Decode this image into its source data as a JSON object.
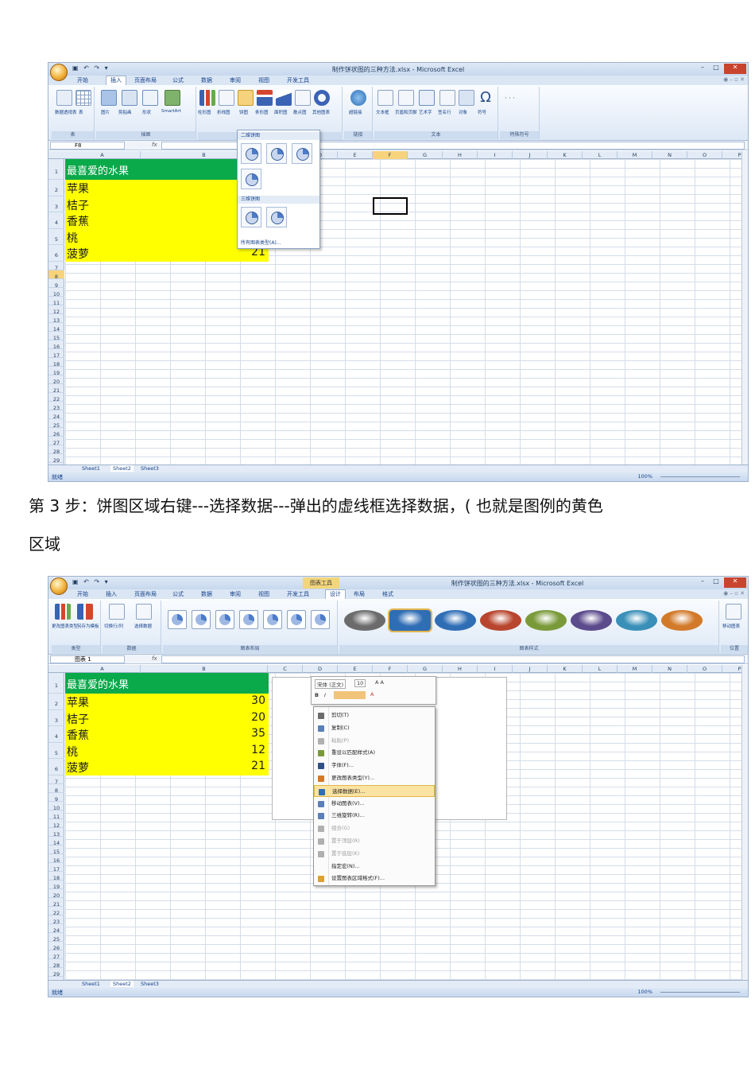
{
  "caption": {
    "line1": "第 3 步：饼图区域右键---选择数据---弹出的虚线框选择数据，( 也就是图例的黄色",
    "line2": "区域"
  },
  "screenshot1": {
    "window_title": "制作饼状图的三种方法.xlsx - Microsoft Excel",
    "tabs": [
      "开始",
      "插入",
      "页面布局",
      "公式",
      "数据",
      "审阅",
      "视图",
      "开发工具"
    ],
    "active_tab": "插入",
    "ribbon_buttons": [
      "数据透视表",
      "表",
      "图片",
      "剪贴画",
      "形状",
      "SmartArt",
      "柱形图",
      "折线图",
      "饼图",
      "条形图",
      "面积图",
      "散点图",
      "其他图表",
      "超链接",
      "文本框",
      "页眉和页脚",
      "艺术字",
      "签名行",
      "对象",
      "符号",
      "特殊符号"
    ],
    "groups": [
      "表",
      "插图",
      "图表",
      "链接",
      "文本",
      "特殊符号"
    ],
    "name_box": "F8",
    "fx": "fx",
    "columns": [
      "A",
      "B",
      "C",
      "D",
      "E",
      "F",
      "G",
      "H",
      "I",
      "J",
      "K",
      "L",
      "M",
      "N",
      "O",
      "P"
    ],
    "selected_column": "F",
    "selected_row": "8",
    "dropdown": {
      "header_2d": "二维饼图",
      "header_3d": "三维饼图",
      "footer": "所有图表类型(A)..."
    },
    "table": {
      "header": "最喜爱的水果",
      "rows": [
        {
          "name": "苹果",
          "value": ""
        },
        {
          "name": "桔子",
          "value": ""
        },
        {
          "name": "香蕉",
          "value": ""
        },
        {
          "name": "桃",
          "value": ""
        },
        {
          "name": "菠萝",
          "value": "21"
        }
      ]
    },
    "sheet_tabs": [
      "Sheet1",
      "Sheet2",
      "Sheet3"
    ],
    "status": "就绪",
    "zoom": "100%"
  },
  "screenshot2": {
    "window_title": "制作饼状图的三种方法.xlsx - Microsoft Excel",
    "tool_title": "图表工具",
    "tabs": [
      "开始",
      "插入",
      "页面布局",
      "公式",
      "数据",
      "审阅",
      "视图",
      "开发工具",
      "设计",
      "布局",
      "格式"
    ],
    "active_tab": "设计",
    "ribbon_buttons": [
      "更改图表类型",
      "另存为模板",
      "切换行/列",
      "选择数据",
      "移动图表"
    ],
    "groups": [
      "类型",
      "数据",
      "图表布局",
      "图表样式",
      "位置"
    ],
    "name_box": "图表 1",
    "fx": "fx",
    "columns": [
      "A",
      "B",
      "C",
      "D",
      "E",
      "F",
      "G",
      "H",
      "I",
      "J",
      "K",
      "L",
      "M",
      "N",
      "O",
      "P"
    ],
    "table": {
      "header": "最喜爱的水果",
      "rows": [
        {
          "name": "苹果",
          "value": "30"
        },
        {
          "name": "桔子",
          "value": "20"
        },
        {
          "name": "香蕉",
          "value": "35"
        },
        {
          "name": "桃",
          "value": "12"
        },
        {
          "name": "菠萝",
          "value": "21"
        }
      ]
    },
    "mini_toolbar": {
      "font": "宋体 (正文)",
      "size": "10"
    },
    "context_menu": [
      {
        "label": "剪切(T)",
        "disabled": false
      },
      {
        "label": "复制(C)",
        "disabled": false
      },
      {
        "label": "粘贴(P)",
        "disabled": true
      },
      {
        "label": "重设以匹配样式(A)",
        "disabled": false
      },
      {
        "label": "字体(F)...",
        "disabled": false
      },
      {
        "label": "更改图表类型(Y)...",
        "disabled": false
      },
      {
        "label": "选择数据(E)...",
        "disabled": false,
        "highlight": true
      },
      {
        "label": "移动图表(V)...",
        "disabled": false
      },
      {
        "label": "三维旋转(R)...",
        "disabled": false
      },
      {
        "label": "组合(G)",
        "disabled": true
      },
      {
        "label": "置于顶层(R)",
        "disabled": true
      },
      {
        "label": "置于底层(K)",
        "disabled": true
      },
      {
        "label": "指定宏(N)...",
        "disabled": false
      },
      {
        "label": "设置图表区域格式(F)...",
        "disabled": false
      }
    ],
    "sheet_tabs": [
      "Sheet1",
      "Sheet2",
      "Sheet3"
    ],
    "status": "就绪",
    "zoom": "100%"
  },
  "colors": {
    "header_green": "#0aa94a",
    "data_yellow": "#ffff00",
    "selected_header": "#f7d37c"
  }
}
